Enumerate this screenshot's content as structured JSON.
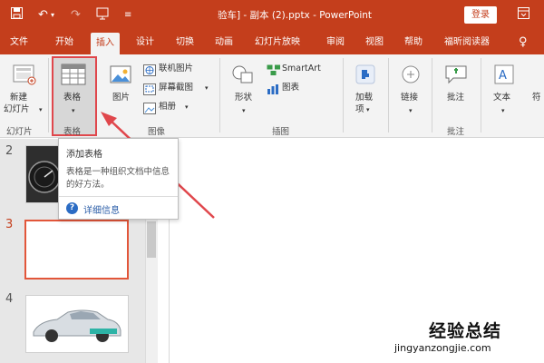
{
  "titlebar": {
    "title": "验车] - 副本 (2).pptx - PowerPoint",
    "login_label": "登录",
    "icons": [
      "save-icon",
      "undo-icon",
      "redo-icon",
      "present-icon",
      "customize-icon",
      "ribbon-options-icon"
    ],
    "undo_glyph": "↶",
    "redo_glyph": "↷",
    "dropdown_glyph": "▾",
    "save_glyph": "💾",
    "present_glyph": "⎚",
    "customize_glyph": "≡",
    "options_glyph": "▣"
  },
  "tabs": [
    "文件",
    "开始",
    "插入",
    "设计",
    "切换",
    "动画",
    "幻灯片放映",
    "审阅",
    "视图",
    "帮助",
    "福昕阅读器"
  ],
  "active_tab": "插入",
  "lightbulb_glyph": "♀",
  "ribbon": {
    "slides_group": {
      "button": "新建",
      "button2": "幻灯片",
      "dropdown": "▾",
      "label": "幻灯片"
    },
    "tables_group": {
      "button": "表格",
      "dropdown": "▾",
      "label": "表格"
    },
    "images_group": {
      "picture": "图片",
      "online_pictures": "联机图片",
      "screenshot": "屏幕截图",
      "album": "相册",
      "label": "图像"
    },
    "illustrations_group": {
      "shapes": "形状",
      "smartart": "SmartArt",
      "chart": "图表",
      "label": "插图"
    },
    "addins": {
      "line1": "加载",
      "line2": "项"
    },
    "links": {
      "label": "链接"
    },
    "comments_group": {
      "button": "批注",
      "label": "批注"
    },
    "text_group": {
      "button": "文本"
    },
    "extra": {
      "button": "符"
    }
  },
  "slides": [
    {
      "number": "2"
    },
    {
      "number": "3"
    },
    {
      "number": "4"
    }
  ],
  "tooltip": {
    "title": "添加表格",
    "description": "表格是一种组织文档中信息的好方法。",
    "help_glyph": "?",
    "more_link": "详细信息"
  },
  "watermark": {
    "line1": "经验总结",
    "line2": "jingyanzongjie.com"
  },
  "colors": {
    "brand": "#c43e1c",
    "highlight": "#e0474c",
    "link": "#2b5ea8"
  }
}
